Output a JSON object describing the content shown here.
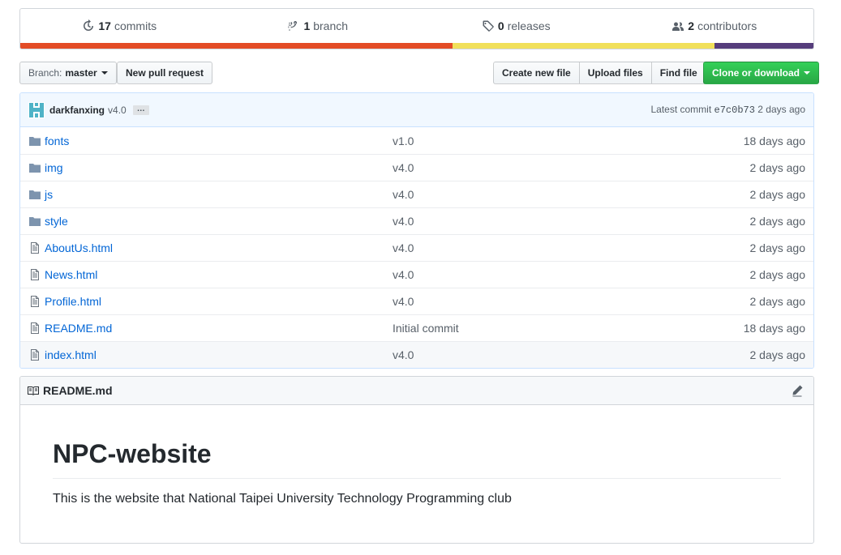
{
  "summary": {
    "commits": {
      "count": "17",
      "label": "commits"
    },
    "branches": {
      "count": "1",
      "label": "branch"
    },
    "releases": {
      "count": "0",
      "label": "releases"
    },
    "contributors": {
      "count": "2",
      "label": "contributors"
    },
    "language_colors": [
      "#e34c26",
      "#f1e05a",
      "#563d7c"
    ],
    "language_shares": [
      0.545,
      0.33,
      0.125
    ]
  },
  "toolbar": {
    "branch_prefix": "Branch:",
    "branch_name": "master",
    "new_pr": "New pull request",
    "create_file": "Create new file",
    "upload_files": "Upload files",
    "find_file": "Find file",
    "clone": "Clone or download"
  },
  "commit": {
    "author": "darkfanxing",
    "message": "v4.0",
    "ellipsis": "…",
    "latest_label": "Latest commit",
    "sha": "e7c0b73",
    "age": "2 days ago"
  },
  "files": [
    {
      "name": "fonts",
      "type": "dir",
      "msg": "v1.0",
      "age": "18 days ago"
    },
    {
      "name": "img",
      "type": "dir",
      "msg": "v4.0",
      "age": "2 days ago"
    },
    {
      "name": "js",
      "type": "dir",
      "msg": "v4.0",
      "age": "2 days ago"
    },
    {
      "name": "style",
      "type": "dir",
      "msg": "v4.0",
      "age": "2 days ago"
    },
    {
      "name": "AboutUs.html",
      "type": "file",
      "msg": "v4.0",
      "age": "2 days ago"
    },
    {
      "name": "News.html",
      "type": "file",
      "msg": "v4.0",
      "age": "2 days ago"
    },
    {
      "name": "Profile.html",
      "type": "file",
      "msg": "v4.0",
      "age": "2 days ago"
    },
    {
      "name": "README.md",
      "type": "file",
      "msg": "Initial commit",
      "age": "18 days ago"
    },
    {
      "name": "index.html",
      "type": "file",
      "msg": "v4.0",
      "age": "2 days ago"
    }
  ],
  "readme": {
    "filename": "README.md",
    "title": "NPC-website",
    "text": "This is the website that National Taipei University Technology Programming club"
  }
}
